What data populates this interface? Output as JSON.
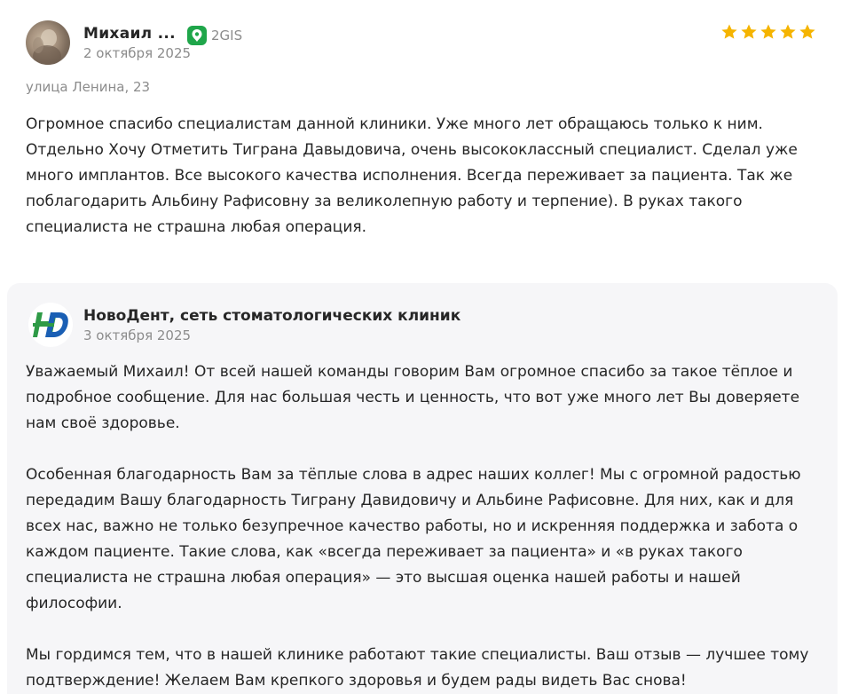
{
  "review": {
    "author": "Михаил ...",
    "source_name": "2GIS",
    "source_icon": "2gis-logo-icon",
    "date": "2 октября 2025",
    "rating": 5,
    "rating_max": 5,
    "star_color": "#f5b400",
    "address": "улица Ленина, 23",
    "text": "Огромное спасибо специалистам данной клиники. Уже много лет обращаюсь только к ним.\nОтдельно Хочу Отметить Тиграна Давыдовича, очень высококлассный специалист. Сделал уже много имплантов. Все высокого качества исполнения. Всегда переживает за пациента. Так же поблагодарить Альбину Рафисовну за великолепную работу и терпение). В руках такого специалиста не страшна любая операция."
  },
  "reply": {
    "company": "НовоДент, сеть стоматологических клиник",
    "logo_text": "HD",
    "date": "3 октября 2025",
    "paragraphs": [
      "Уважаемый Михаил! От всей нашей команды говорим Вам огромное спасибо за такое тёплое и подробное сообщение. Для нас большая честь и ценность, что вот уже много лет Вы доверяете нам своё здоровье.",
      "Особенная благодарность Вам за тёплые слова в адрес наших коллег! Мы с огромной радостью передадим Вашу благодарность Тиграну Давидовичу и Альбине Рафисовне. Для них, как и для всех нас, важно не только безупречное качество работы, но и искренняя поддержка и забота о каждом пациенте. Такие слова, как «всегда переживает за пациента» и «в руках такого специалиста не страшна любая операция» — это высшая оценка нашей работы и нашей философии.",
      "Мы гордимся тем, что в нашей клинике работают такие специалисты. Ваш отзыв — лучшее тому подтверждение! Желаем Вам крепкого здоровья и будем рады видеть Вас снова!"
    ]
  }
}
